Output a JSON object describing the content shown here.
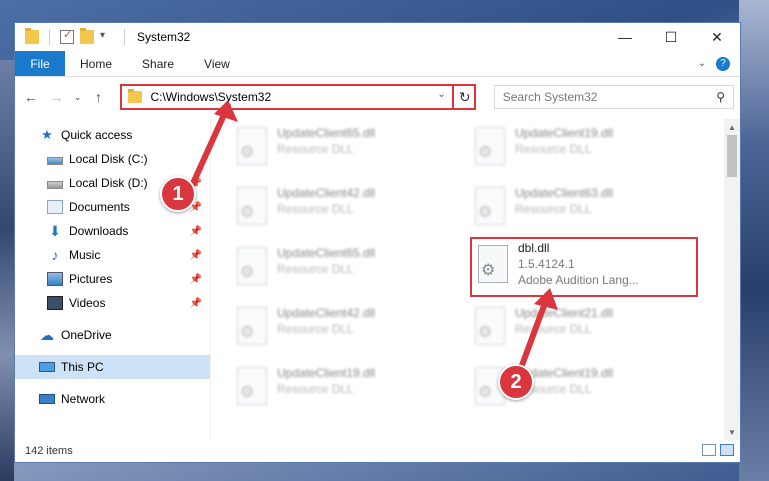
{
  "window": {
    "title": "System32"
  },
  "ribbon": {
    "file": "File",
    "tabs": [
      "Home",
      "Share",
      "View"
    ]
  },
  "nav": {
    "back": "←",
    "forward": "→",
    "up": "↑"
  },
  "address": {
    "path": "C:\\Windows\\System32",
    "refresh": "↻",
    "dropdown": "⌄"
  },
  "search": {
    "placeholder": "Search System32",
    "icon": "⚲"
  },
  "sidebar": {
    "items": [
      {
        "label": "Quick access",
        "icon": "star-icon"
      },
      {
        "label": "Local Disk (C:)",
        "icon": "disk-icon"
      },
      {
        "label": "Local Disk (D:)",
        "icon": "disk-icon"
      },
      {
        "label": "Documents",
        "icon": "documents-icon"
      },
      {
        "label": "Downloads",
        "icon": "downloads-icon"
      },
      {
        "label": "Music",
        "icon": "music-icon"
      },
      {
        "label": "Pictures",
        "icon": "pictures-icon"
      },
      {
        "label": "Videos",
        "icon": "videos-icon"
      },
      {
        "label": "OneDrive",
        "icon": "onedrive-icon"
      },
      {
        "label": "This PC",
        "icon": "this-pc-icon"
      },
      {
        "label": "Network",
        "icon": "network-icon"
      }
    ]
  },
  "files": [
    {
      "name": "UpdateClient65.dll",
      "type": "Resource DLL"
    },
    {
      "name": "UpdateClient19.dll",
      "type": "Resource DLL"
    },
    {
      "name": "UpdateClient42.dll",
      "type": "Resource DLL"
    },
    {
      "name": "UpdateClient63.dll",
      "type": "Resource DLL"
    },
    {
      "name": "UpdateClient65.dll",
      "type": "Resource DLL"
    },
    {
      "name": "dbl.dll",
      "version": "1.5.4124.1",
      "description": "Adobe Audition Lang..."
    },
    {
      "name": "UpdateClient42.dll",
      "type": "Resource DLL"
    },
    {
      "name": "UpdateClient21.dll",
      "type": "Resource DLL"
    },
    {
      "name": "UpdateClient19.dll",
      "type": "Resource DLL"
    },
    {
      "name": "UpdateClient19.dll",
      "type": "Resource DLL"
    }
  ],
  "status": {
    "count": "142 items"
  },
  "annotations": {
    "badge1": "1",
    "badge2": "2",
    "accent": "#d9363e"
  }
}
